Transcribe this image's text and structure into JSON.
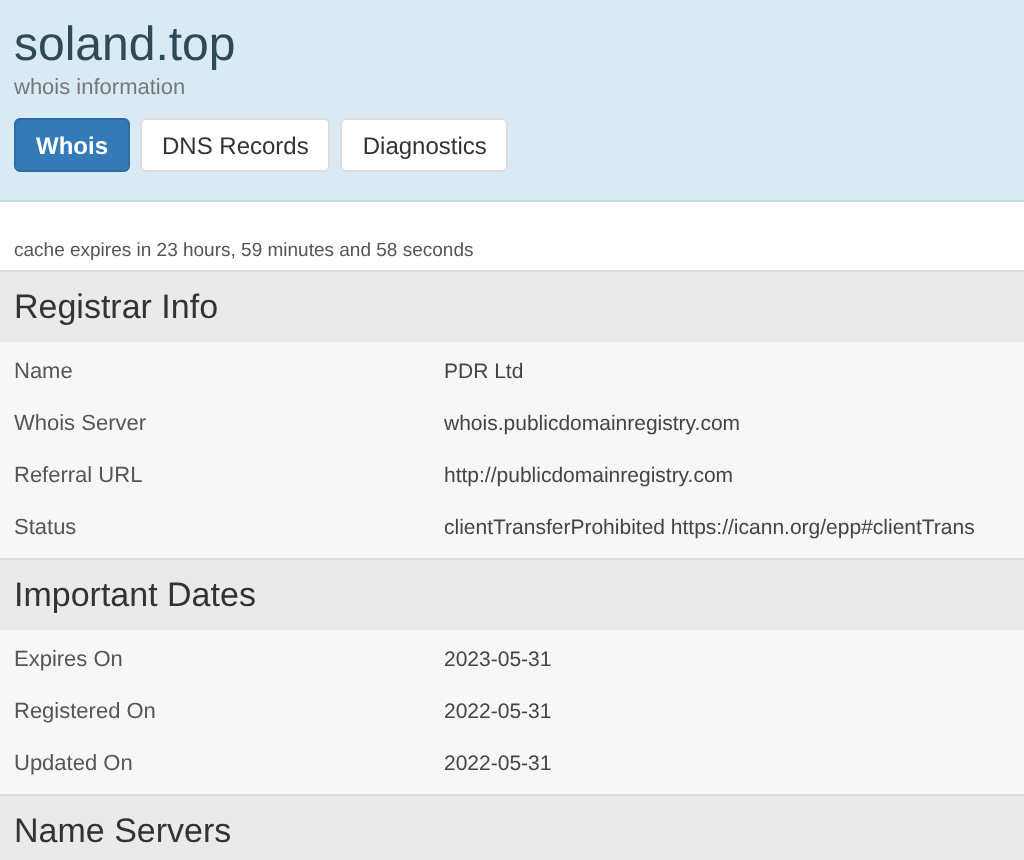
{
  "header": {
    "title": "soland.top",
    "subtitle": "whois information"
  },
  "tabs": [
    {
      "label": "Whois",
      "selected": true
    },
    {
      "label": "DNS Records",
      "selected": false
    },
    {
      "label": "Diagnostics",
      "selected": false
    }
  ],
  "cache_note": "cache expires in 23 hours, 59 minutes and 58 seconds",
  "sections": [
    {
      "title": "Registrar Info",
      "rows": [
        {
          "label": "Name",
          "value": "PDR Ltd"
        },
        {
          "label": "Whois Server",
          "value": "whois.publicdomainregistry.com"
        },
        {
          "label": "Referral URL",
          "value": "http://publicdomainregistry.com"
        },
        {
          "label": "Status",
          "value": "clientTransferProhibited https://icann.org/epp#clientTrans"
        }
      ]
    },
    {
      "title": "Important Dates",
      "rows": [
        {
          "label": "Expires On",
          "value": "2023-05-31"
        },
        {
          "label": "Registered On",
          "value": "2022-05-31"
        },
        {
          "label": "Updated On",
          "value": "2022-05-31"
        }
      ]
    },
    {
      "title": "Name Servers"
    }
  ]
}
